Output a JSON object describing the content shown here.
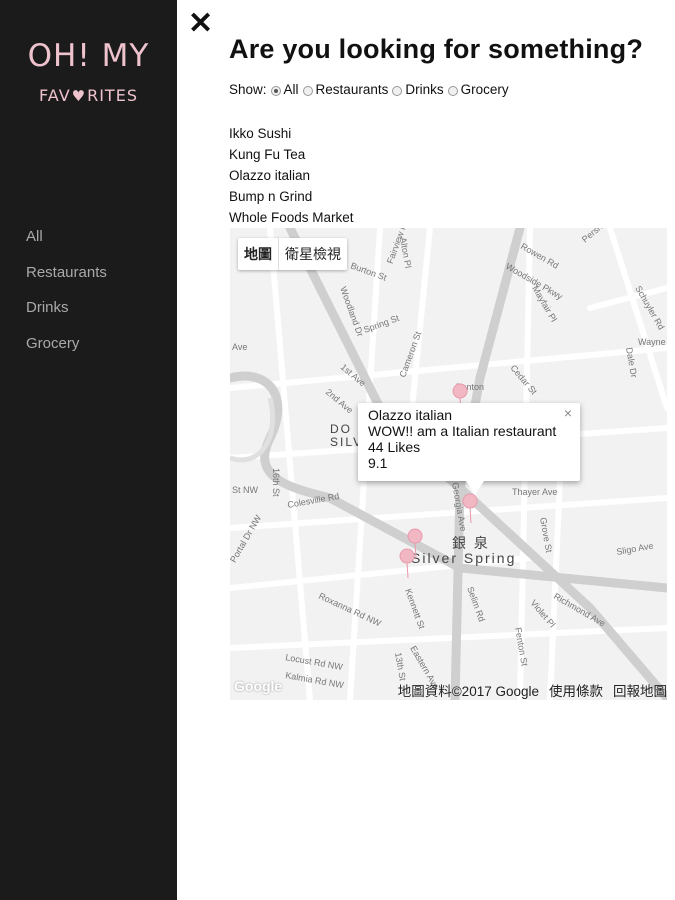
{
  "sidebar": {
    "logo_line1": "OH! MY",
    "logo_line2_a": "FAV",
    "logo_line2_b": "RITES",
    "items": [
      {
        "label": "All"
      },
      {
        "label": "Restaurants"
      },
      {
        "label": "Drinks"
      },
      {
        "label": "Grocery"
      }
    ]
  },
  "close_label": "✕",
  "title": "Are you looking for something?",
  "filters": {
    "prefix": "Show:",
    "options": [
      {
        "label": "All",
        "checked": true
      },
      {
        "label": "Restaurants",
        "checked": false
      },
      {
        "label": "Drinks",
        "checked": false
      },
      {
        "label": "Grocery",
        "checked": false
      }
    ]
  },
  "places": [
    "Ikko Sushi",
    "Kung Fu Tea",
    "Olazzo italian",
    "Bump n Grind",
    "Whole Foods Market"
  ],
  "map": {
    "type_buttons": [
      "地圖",
      "衛星檢視"
    ],
    "infowindow": {
      "name": "Olazzo italian",
      "description": "WOW!! am a Italian restaurant",
      "likes": "44 Likes",
      "rating": "9.1",
      "close": "×"
    },
    "footer": [
      "地圖資料©2017 Google",
      "使用條款",
      "回報地圖"
    ],
    "logo": "Google",
    "area_label_cjk": "銀 泉",
    "area_label": "Silver Spring",
    "area_partial": [
      "DO",
      "SILV"
    ],
    "street_labels": [
      "Rowen Rd",
      "Woodside Pkwy",
      "Mayfair Pl",
      "Pershing",
      "Alton Pl",
      "Fairview Rd",
      "Burton St",
      "Woodland Dr",
      "Spring St",
      "Cameron St",
      "Cedar St",
      "1st Ave",
      "2nd Ave",
      "Fenton",
      "Georgia Ave",
      "Thayer Ave",
      "Grove St",
      "Colesville Rd",
      "16th St",
      "Sligo Ave",
      "Richmond Ave",
      "Roxanna Rd NW",
      "Kennett St",
      "Selim Rd",
      "Violet Pl",
      "Fenton St",
      "Eastern Ave",
      "Locust Rd NW",
      "Kalmia Rd NW",
      "13th St",
      "Schuyler Rd",
      "Dale Dr",
      "Wayne",
      "St NW",
      "Portal Dr NW",
      "Ave"
    ],
    "marker_color": "#f1b7c3"
  }
}
